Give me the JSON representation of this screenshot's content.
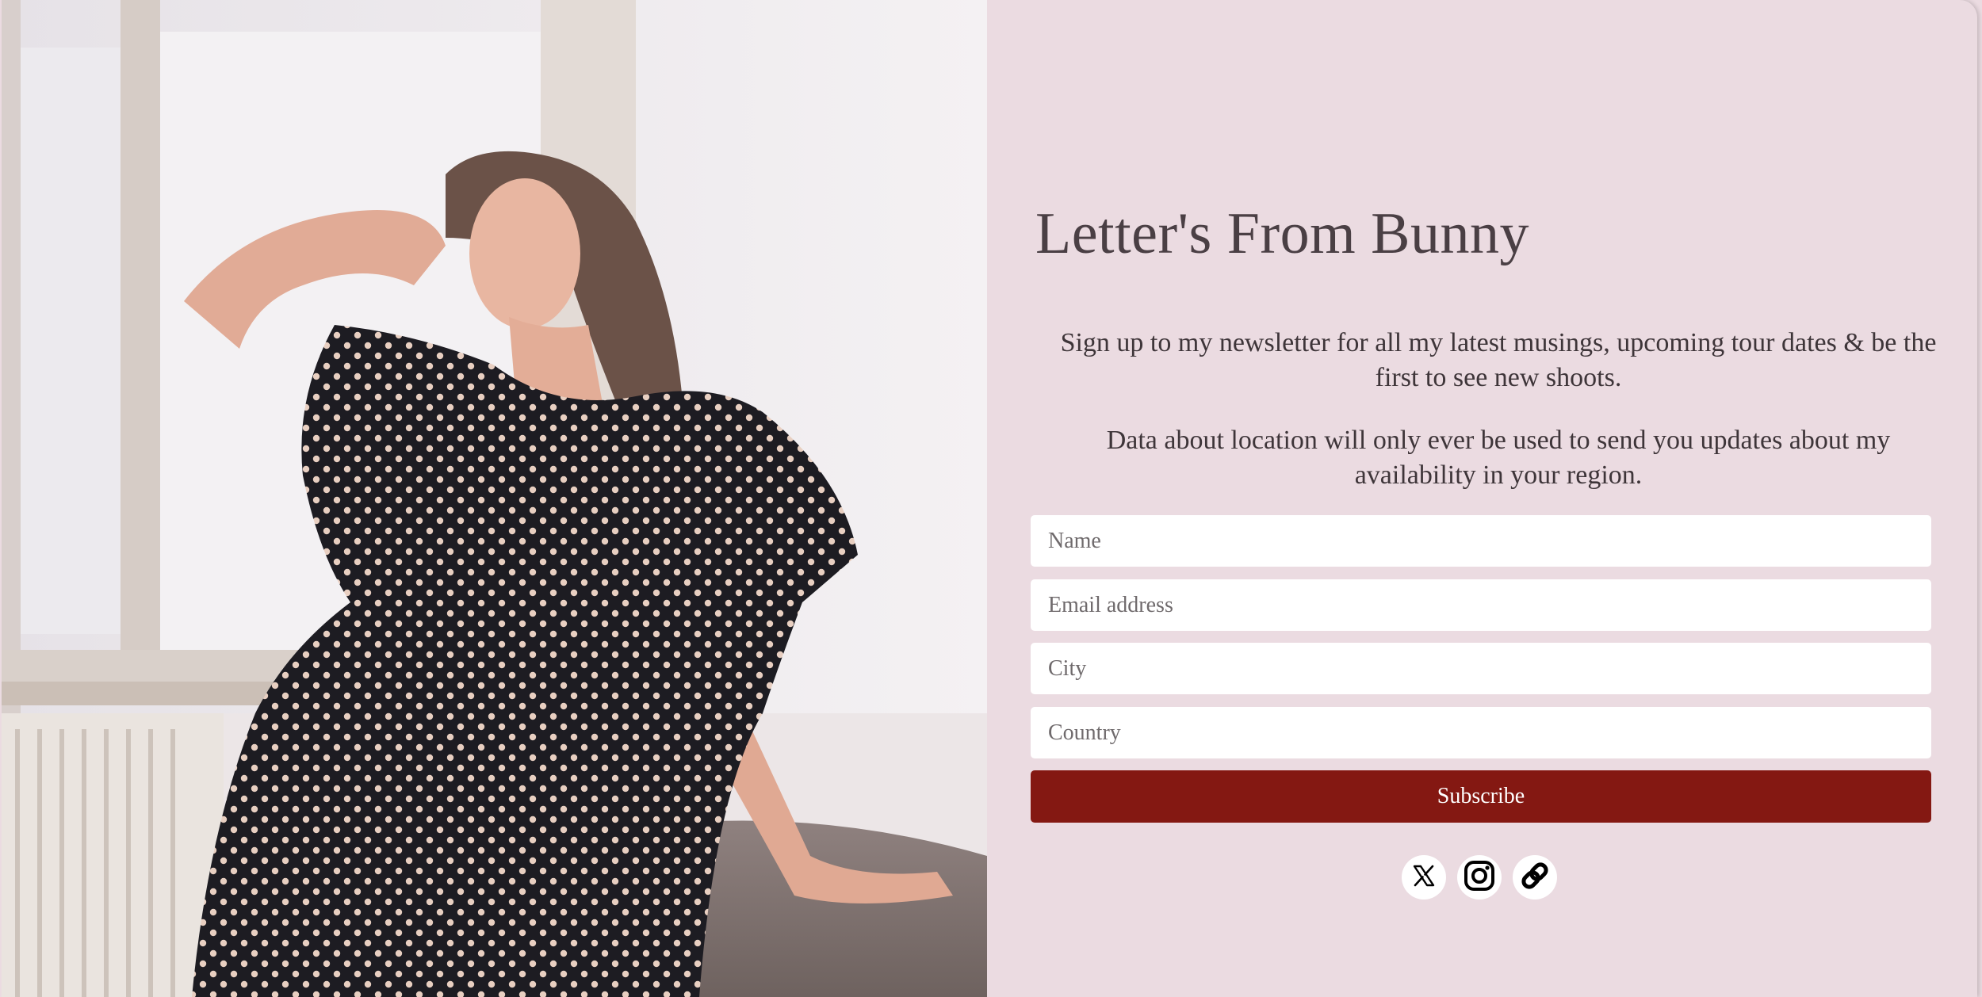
{
  "hero": {
    "title": "Letter's From Bunny",
    "intro": "Sign up to my newsletter for all my latest musings, upcoming tour dates & be the first to see new shoots.",
    "privacy_note": "Data about location will only ever be used to send you updates about my availability in your region."
  },
  "form": {
    "name_placeholder": "Name",
    "email_placeholder": "Email address",
    "city_placeholder": "City",
    "country_placeholder": "Country",
    "submit_label": "Subscribe"
  },
  "socials": [
    {
      "icon": "x-twitter-icon"
    },
    {
      "icon": "instagram-icon"
    },
    {
      "icon": "link-icon"
    }
  ],
  "colors": {
    "background": "#ebdbe1",
    "accent": "#841812",
    "text": "#4a3f44"
  }
}
